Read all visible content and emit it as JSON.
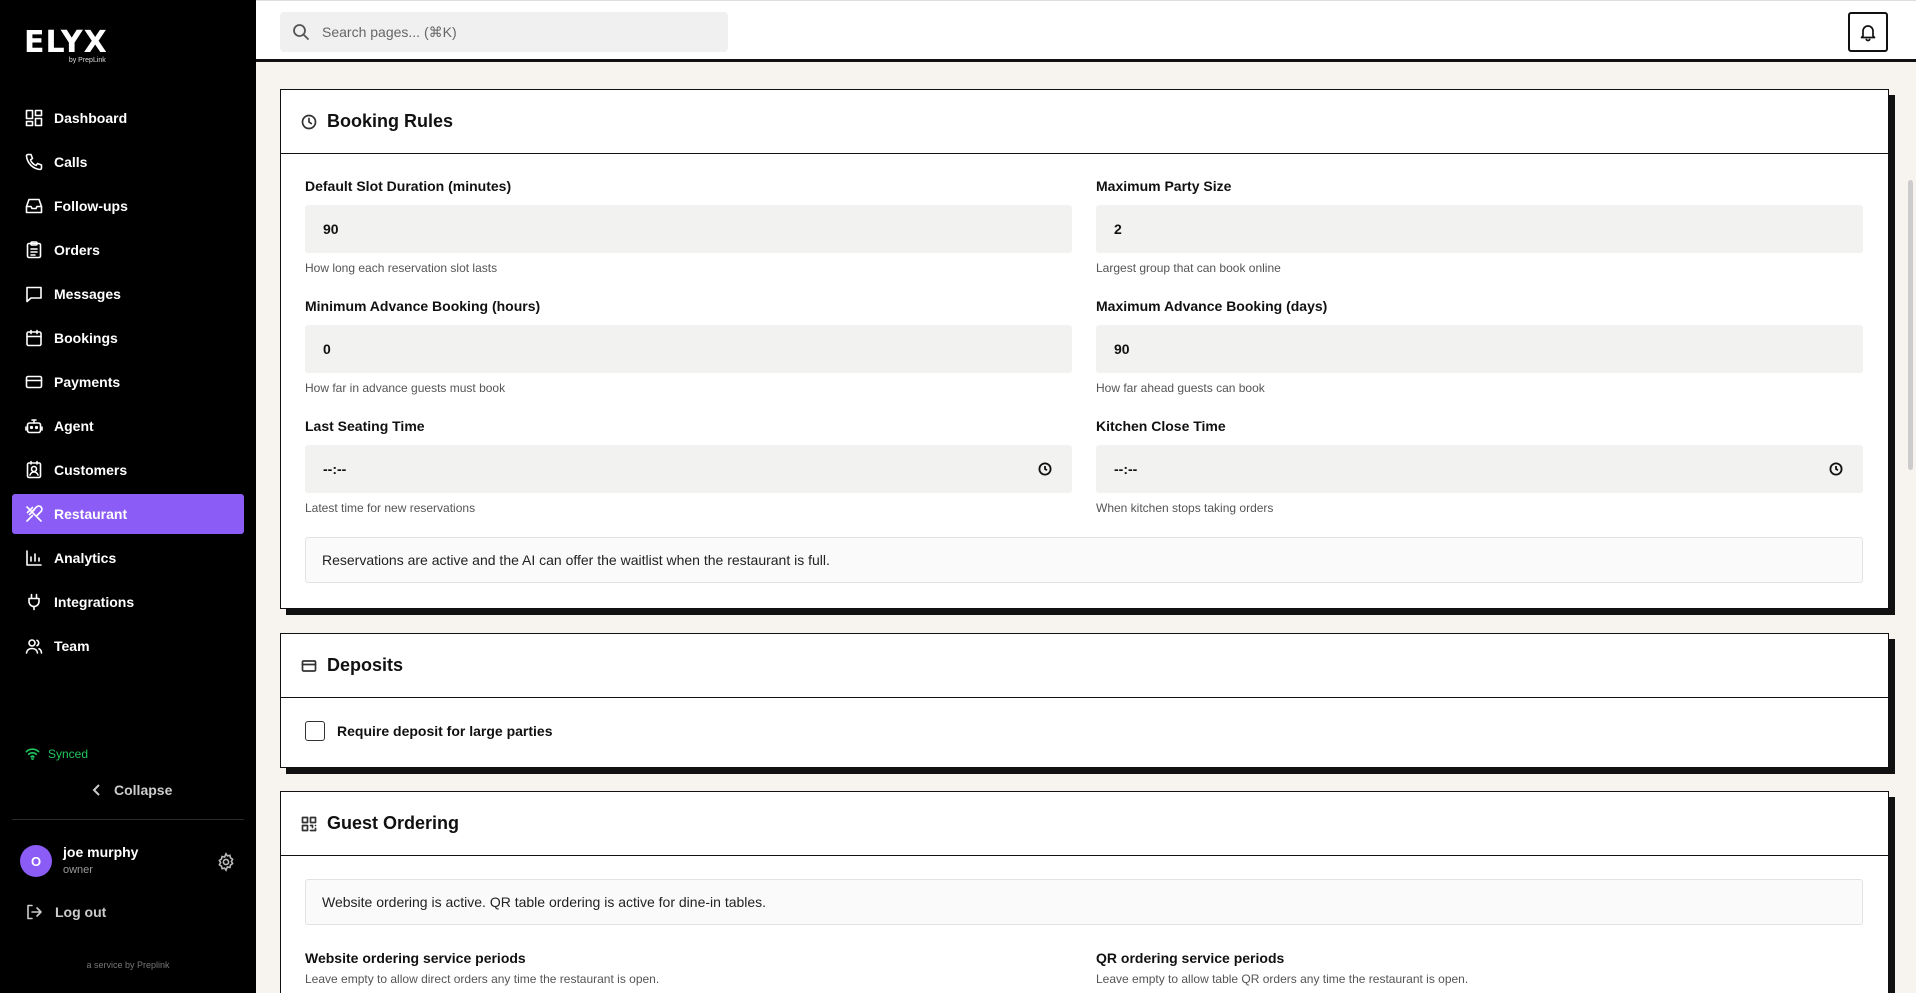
{
  "brand": {
    "name": "ELYX",
    "tagline": "by PrepLink",
    "footer": "a service by Preplink"
  },
  "sidebar": {
    "items": [
      {
        "label": "Dashboard",
        "icon": "dashboard-icon"
      },
      {
        "label": "Calls",
        "icon": "phone-icon"
      },
      {
        "label": "Follow-ups",
        "icon": "inbox-icon"
      },
      {
        "label": "Orders",
        "icon": "clipboard-icon"
      },
      {
        "label": "Messages",
        "icon": "message-icon"
      },
      {
        "label": "Bookings",
        "icon": "calendar-icon"
      },
      {
        "label": "Payments",
        "icon": "credit-card-icon"
      },
      {
        "label": "Agent",
        "icon": "robot-icon"
      },
      {
        "label": "Customers",
        "icon": "contact-icon"
      },
      {
        "label": "Restaurant",
        "icon": "utensils-icon",
        "active": true
      },
      {
        "label": "Analytics",
        "icon": "bar-chart-icon"
      },
      {
        "label": "Integrations",
        "icon": "plug-icon"
      },
      {
        "label": "Team",
        "icon": "users-icon"
      }
    ],
    "status": "Synced",
    "collapse_label": "Collapse",
    "user": {
      "initial": "O",
      "name": "joe murphy",
      "role": "owner"
    },
    "logout_label": "Log out"
  },
  "header": {
    "search_placeholder": "Search pages... (⌘K)"
  },
  "booking_rules": {
    "title": "Booking Rules",
    "fields": [
      {
        "label": "Default Slot Duration (minutes)",
        "value": "90",
        "help": "How long each reservation slot lasts"
      },
      {
        "label": "Maximum Party Size",
        "value": "2",
        "help": "Largest group that can book online"
      },
      {
        "label": "Minimum Advance Booking (hours)",
        "value": "0",
        "help": "How far in advance guests must book"
      },
      {
        "label": "Maximum Advance Booking (days)",
        "value": "90",
        "help": "How far ahead guests can book"
      },
      {
        "label": "Last Seating Time",
        "value": "--:--",
        "help": "Latest time for new reservations"
      },
      {
        "label": "Kitchen Close Time",
        "value": "--:--",
        "help": "When kitchen stops taking orders"
      }
    ],
    "notice": "Reservations are active and the AI can offer the waitlist when the restaurant is full."
  },
  "deposits": {
    "title": "Deposits",
    "checkbox_label": "Require deposit for large parties",
    "checked": false
  },
  "guest_ordering": {
    "title": "Guest Ordering",
    "notice": "Website ordering is active. QR table ordering is active for dine-in tables.",
    "website_label": "Website ordering service periods",
    "website_help": "Leave empty to allow direct orders any time the restaurant is open.",
    "qr_label": "QR ordering service periods",
    "qr_help": "Leave empty to allow table QR orders any time the restaurant is open."
  },
  "colors": {
    "accent": "#8b5cf6",
    "sidebar": "#000000",
    "synced": "#22c55e",
    "background": "#f7f3ee"
  }
}
